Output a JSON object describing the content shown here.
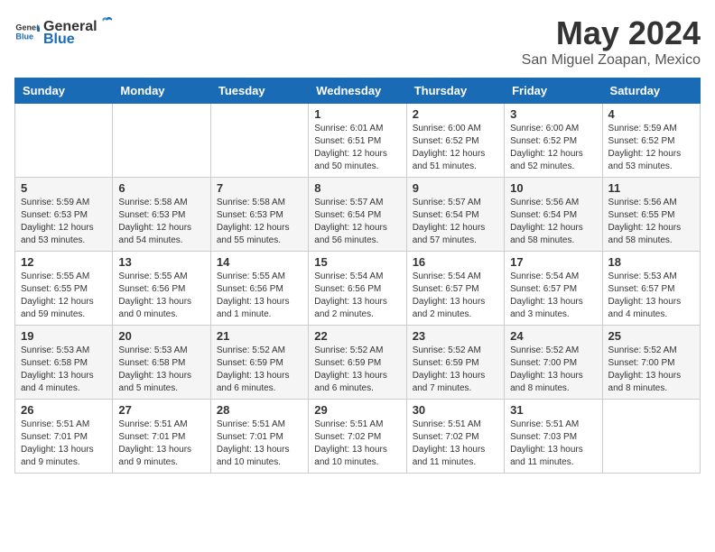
{
  "header": {
    "logo_general": "General",
    "logo_blue": "Blue",
    "month_title": "May 2024",
    "location": "San Miguel Zoapan, Mexico"
  },
  "weekdays": [
    "Sunday",
    "Monday",
    "Tuesday",
    "Wednesday",
    "Thursday",
    "Friday",
    "Saturday"
  ],
  "weeks": [
    [
      {
        "day": "",
        "info": ""
      },
      {
        "day": "",
        "info": ""
      },
      {
        "day": "",
        "info": ""
      },
      {
        "day": "1",
        "info": "Sunrise: 6:01 AM\nSunset: 6:51 PM\nDaylight: 12 hours and 50 minutes."
      },
      {
        "day": "2",
        "info": "Sunrise: 6:00 AM\nSunset: 6:52 PM\nDaylight: 12 hours and 51 minutes."
      },
      {
        "day": "3",
        "info": "Sunrise: 6:00 AM\nSunset: 6:52 PM\nDaylight: 12 hours and 52 minutes."
      },
      {
        "day": "4",
        "info": "Sunrise: 5:59 AM\nSunset: 6:52 PM\nDaylight: 12 hours and 53 minutes."
      }
    ],
    [
      {
        "day": "5",
        "info": "Sunrise: 5:59 AM\nSunset: 6:53 PM\nDaylight: 12 hours and 53 minutes."
      },
      {
        "day": "6",
        "info": "Sunrise: 5:58 AM\nSunset: 6:53 PM\nDaylight: 12 hours and 54 minutes."
      },
      {
        "day": "7",
        "info": "Sunrise: 5:58 AM\nSunset: 6:53 PM\nDaylight: 12 hours and 55 minutes."
      },
      {
        "day": "8",
        "info": "Sunrise: 5:57 AM\nSunset: 6:54 PM\nDaylight: 12 hours and 56 minutes."
      },
      {
        "day": "9",
        "info": "Sunrise: 5:57 AM\nSunset: 6:54 PM\nDaylight: 12 hours and 57 minutes."
      },
      {
        "day": "10",
        "info": "Sunrise: 5:56 AM\nSunset: 6:54 PM\nDaylight: 12 hours and 58 minutes."
      },
      {
        "day": "11",
        "info": "Sunrise: 5:56 AM\nSunset: 6:55 PM\nDaylight: 12 hours and 58 minutes."
      }
    ],
    [
      {
        "day": "12",
        "info": "Sunrise: 5:55 AM\nSunset: 6:55 PM\nDaylight: 12 hours and 59 minutes."
      },
      {
        "day": "13",
        "info": "Sunrise: 5:55 AM\nSunset: 6:56 PM\nDaylight: 13 hours and 0 minutes."
      },
      {
        "day": "14",
        "info": "Sunrise: 5:55 AM\nSunset: 6:56 PM\nDaylight: 13 hours and 1 minute."
      },
      {
        "day": "15",
        "info": "Sunrise: 5:54 AM\nSunset: 6:56 PM\nDaylight: 13 hours and 2 minutes."
      },
      {
        "day": "16",
        "info": "Sunrise: 5:54 AM\nSunset: 6:57 PM\nDaylight: 13 hours and 2 minutes."
      },
      {
        "day": "17",
        "info": "Sunrise: 5:54 AM\nSunset: 6:57 PM\nDaylight: 13 hours and 3 minutes."
      },
      {
        "day": "18",
        "info": "Sunrise: 5:53 AM\nSunset: 6:57 PM\nDaylight: 13 hours and 4 minutes."
      }
    ],
    [
      {
        "day": "19",
        "info": "Sunrise: 5:53 AM\nSunset: 6:58 PM\nDaylight: 13 hours and 4 minutes."
      },
      {
        "day": "20",
        "info": "Sunrise: 5:53 AM\nSunset: 6:58 PM\nDaylight: 13 hours and 5 minutes."
      },
      {
        "day": "21",
        "info": "Sunrise: 5:52 AM\nSunset: 6:59 PM\nDaylight: 13 hours and 6 minutes."
      },
      {
        "day": "22",
        "info": "Sunrise: 5:52 AM\nSunset: 6:59 PM\nDaylight: 13 hours and 6 minutes."
      },
      {
        "day": "23",
        "info": "Sunrise: 5:52 AM\nSunset: 6:59 PM\nDaylight: 13 hours and 7 minutes."
      },
      {
        "day": "24",
        "info": "Sunrise: 5:52 AM\nSunset: 7:00 PM\nDaylight: 13 hours and 8 minutes."
      },
      {
        "day": "25",
        "info": "Sunrise: 5:52 AM\nSunset: 7:00 PM\nDaylight: 13 hours and 8 minutes."
      }
    ],
    [
      {
        "day": "26",
        "info": "Sunrise: 5:51 AM\nSunset: 7:01 PM\nDaylight: 13 hours and 9 minutes."
      },
      {
        "day": "27",
        "info": "Sunrise: 5:51 AM\nSunset: 7:01 PM\nDaylight: 13 hours and 9 minutes."
      },
      {
        "day": "28",
        "info": "Sunrise: 5:51 AM\nSunset: 7:01 PM\nDaylight: 13 hours and 10 minutes."
      },
      {
        "day": "29",
        "info": "Sunrise: 5:51 AM\nSunset: 7:02 PM\nDaylight: 13 hours and 10 minutes."
      },
      {
        "day": "30",
        "info": "Sunrise: 5:51 AM\nSunset: 7:02 PM\nDaylight: 13 hours and 11 minutes."
      },
      {
        "day": "31",
        "info": "Sunrise: 5:51 AM\nSunset: 7:03 PM\nDaylight: 13 hours and 11 minutes."
      },
      {
        "day": "",
        "info": ""
      }
    ]
  ]
}
